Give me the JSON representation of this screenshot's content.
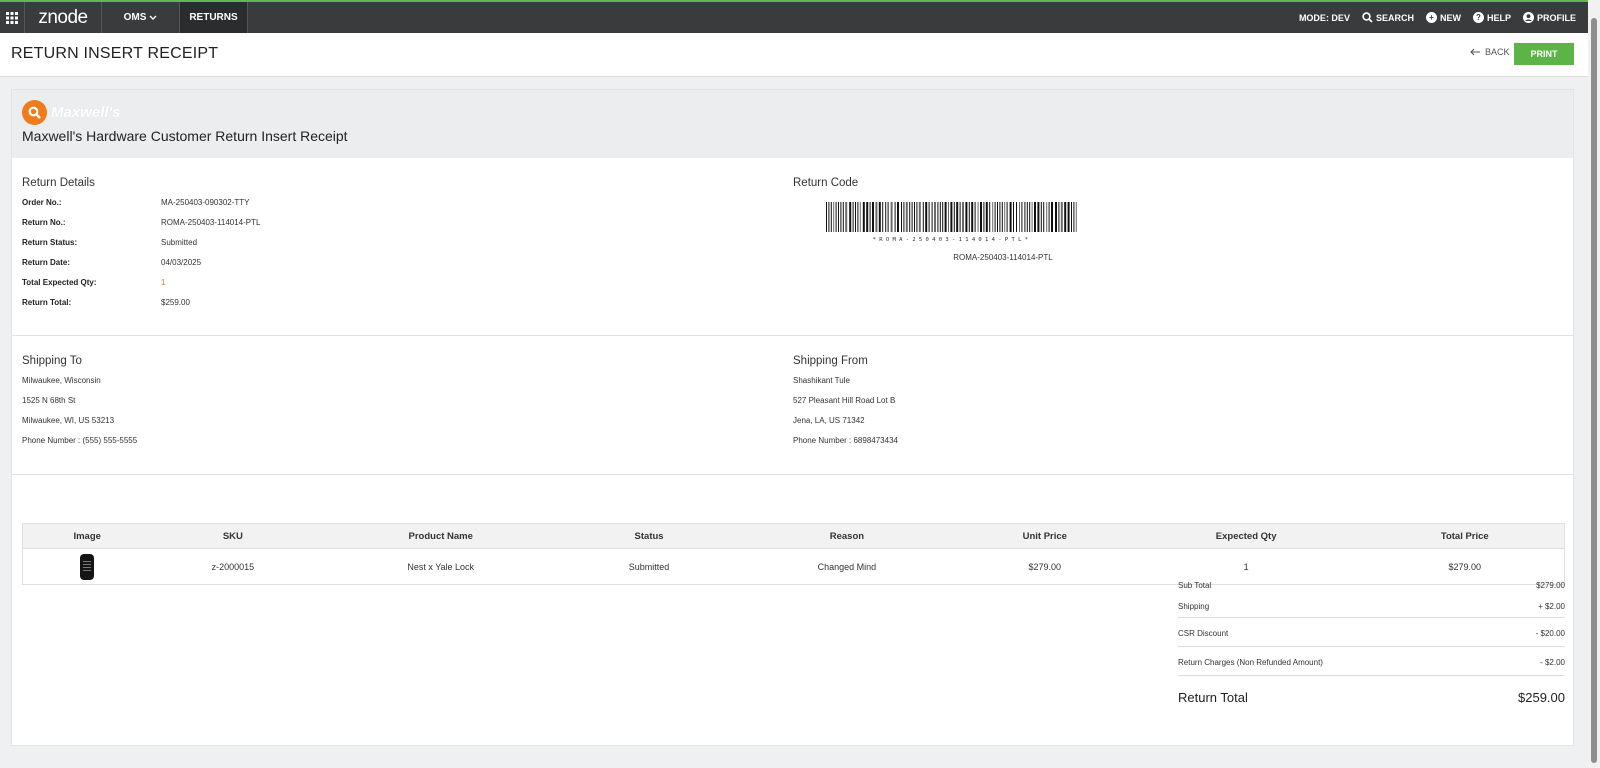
{
  "nav": {
    "logo": "znode",
    "oms_label": "OMS",
    "returns_label": "RETURNS",
    "mode_label": "MODE: DEV",
    "search_label": "SEARCH",
    "new_label": "NEW",
    "help_label": "HELP",
    "profile_label": "PROFILE"
  },
  "header": {
    "title": "RETURN INSERT RECEIPT",
    "back_label": "BACK",
    "print_label": "PRINT"
  },
  "banner": {
    "brand_name": "Maxwell's",
    "title": "Maxwell's Hardware Customer Return Insert Receipt"
  },
  "return_details": {
    "title": "Return Details",
    "rows": [
      {
        "label": "Order No.:",
        "value": "MA-250403-090302-TTY"
      },
      {
        "label": "Return No.:",
        "value": "ROMA-250403-114014-PTL"
      },
      {
        "label": "Return Status:",
        "value": "Submitted"
      },
      {
        "label": "Return Date:",
        "value": "04/03/2025"
      },
      {
        "label": "Total Expected Qty:",
        "value": "1"
      },
      {
        "label": "Return Total:",
        "value": "$259.00"
      }
    ]
  },
  "return_code": {
    "title": "Return Code",
    "barcode_text": "*ROMA-250403-114014-PTL*",
    "code": "ROMA-250403-114014-PTL"
  },
  "shipping_to": {
    "title": "Shipping To",
    "lines": [
      "Milwaukee, Wisconsin",
      "1525 N 68th St",
      "Milwaukee, WI, US 53213",
      "Phone Number : (555) 555-5555"
    ]
  },
  "shipping_from": {
    "title": "Shipping From",
    "lines": [
      "Shashikant Tule",
      "527 Pleasant Hill Road Lot B",
      "Jena, LA, US 71342",
      "Phone Number : 6898473434"
    ]
  },
  "table": {
    "headers": [
      "Image",
      "SKU",
      "Product Name",
      "Status",
      "Reason",
      "Unit Price",
      "Expected Qty",
      "Total Price"
    ],
    "rows": [
      {
        "image": "lock-product-image",
        "sku": "z-2000015",
        "product": "Nest x Yale Lock",
        "status": "Submitted",
        "reason": "Changed Mind",
        "unit_price": "$279.00",
        "qty": "1",
        "total": "$279.00"
      }
    ]
  },
  "totals": {
    "subtotal_label": "Sub Total",
    "subtotal": "$279.00",
    "shipping_label": "Shipping",
    "shipping": "+ $2.00",
    "csr_label": "CSR Discount",
    "csr": "- $20.00",
    "charges_label": "Return Charges (Non Refunded Amount)",
    "charges": "- $2.00",
    "grand_label": "Return Total",
    "grand": "$259.00"
  },
  "colors": {
    "nav_bg": "#3a3b3d",
    "accent_green": "#5cb446",
    "brand_orange": "#f07b1b"
  }
}
